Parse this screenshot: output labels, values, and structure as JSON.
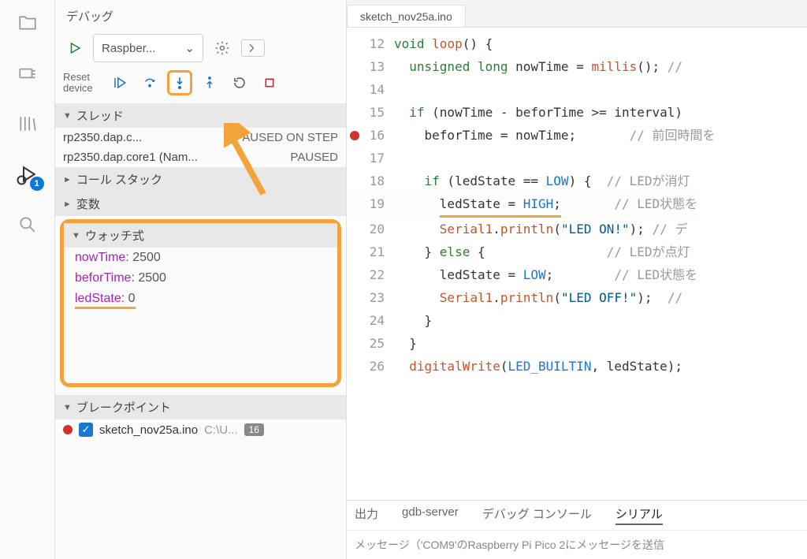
{
  "sidebar_title": "デバッグ",
  "run_config": "Raspber...",
  "reset_label1": "Reset",
  "reset_label2": "device",
  "debug_badge": "1",
  "sections": {
    "threads": "スレッド",
    "callstack": "コール スタック",
    "variables": "変数",
    "watch": "ウォッチ式",
    "breakpoints": "ブレークポイント"
  },
  "threads": [
    {
      "name": "rp2350.dap.c...",
      "state": "PAUSED ON STEP"
    },
    {
      "name": "rp2350.dap.core1 (Nam...",
      "state": "PAUSED"
    }
  ],
  "watches": [
    {
      "name": "nowTime",
      "value": "2500",
      "underline": false
    },
    {
      "name": "beforTime",
      "value": "2500",
      "underline": false
    },
    {
      "name": "ledState",
      "value": "0",
      "underline": true
    }
  ],
  "breakpoints": [
    {
      "file": "sketch_nov25a.ino",
      "path": "C:\\U...",
      "line": "16"
    }
  ],
  "tab_name": "sketch_nov25a.ino",
  "code_lines": [
    {
      "n": 12,
      "html": "<span class='kw'>void</span> <span class='fn'>loop</span>() {",
      "bp": false
    },
    {
      "n": 13,
      "html": "  <span class='kw'>unsigned</span> <span class='kw'>long</span> nowTime = <span class='fn'>millis</span>(); <span class='cmt'>// </span>",
      "bp": false
    },
    {
      "n": 14,
      "html": "",
      "bp": false
    },
    {
      "n": 15,
      "html": "  <span class='kw'>if</span> (nowTime - beforTime &gt;= interval) ",
      "bp": false
    },
    {
      "n": 16,
      "html": "    beforTime = nowTime;       <span class='cmt'>// 前回時間を</span>",
      "bp": true
    },
    {
      "n": 17,
      "html": "",
      "bp": false
    },
    {
      "n": 18,
      "html": "    <span class='kw'>if</span> (ledState == <span class='const'>LOW</span>) {  <span class='cmt'>// LEDが消灯</span>",
      "bp": false
    },
    {
      "n": 19,
      "html": "      <span class='src-underline'>ledState = <span class='const'>HIGH</span>;</span>       <span class='cmt'>// LED状態を</span>",
      "bp": false,
      "current": true
    },
    {
      "n": 20,
      "html": "      <span class='fn'>Serial1</span>.<span class='fn'>println</span>(<span class='str'>\"LED ON!\"</span>); <span class='cmt'>// デ</span>",
      "bp": false
    },
    {
      "n": 21,
      "html": "    } <span class='kw'>else</span> {                <span class='cmt'>// LEDが点灯</span>",
      "bp": false
    },
    {
      "n": 22,
      "html": "      ledState = <span class='const'>LOW</span>;        <span class='cmt'>// LED状態を</span>",
      "bp": false
    },
    {
      "n": 23,
      "html": "      <span class='fn'>Serial1</span>.<span class='fn'>println</span>(<span class='str'>\"LED OFF!\"</span>);  <span class='cmt'>//</span>",
      "bp": false
    },
    {
      "n": 24,
      "html": "    }",
      "bp": false
    },
    {
      "n": 25,
      "html": "  }",
      "bp": false
    },
    {
      "n": 26,
      "html": "  <span class='fn'>digitalWrite</span>(<span class='const'>LED_BUILTIN</span>, ledState);",
      "bp": false
    }
  ],
  "bottom_tabs": [
    "出力",
    "gdb-server",
    "デバッグ コンソール",
    "シリアル"
  ],
  "msg_placeholder": "メッセージ（'COM9'のRaspberry Pi Pico 2にメッセージを送信"
}
